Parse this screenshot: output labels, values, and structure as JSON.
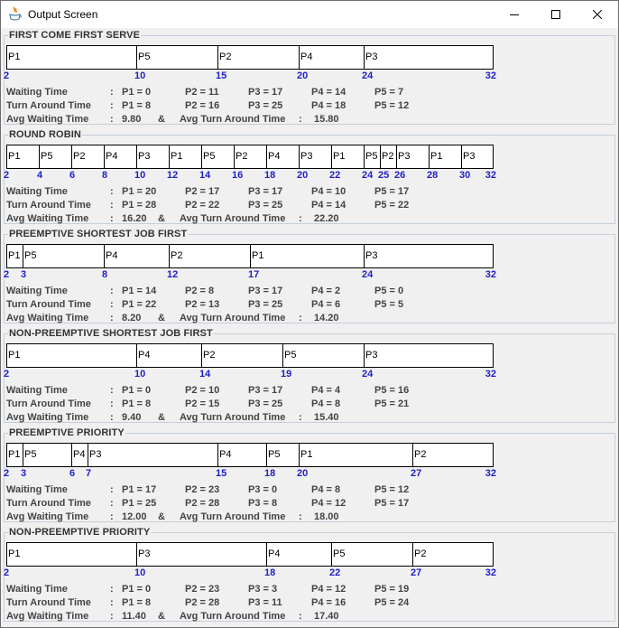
{
  "window": {
    "title": "Output Screen"
  },
  "labels": {
    "waiting": "Waiting Time",
    "turnaround": "Turn Around Time",
    "avg_waiting": "Avg Waiting Time",
    "avg_turnaround": "Avg Turn Around Time",
    "amp": "&"
  },
  "sections": [
    {
      "title": "FIRST COME FIRST SERVE",
      "segments": [
        "P1",
        "P5",
        "P2",
        "P4",
        "P3"
      ],
      "ticks": [
        "2",
        "10",
        "15",
        "20",
        "24",
        "32"
      ],
      "waiting": [
        "P1 = 0",
        "P2 = 11",
        "P3 = 17",
        "P4 = 14",
        "P5 = 7"
      ],
      "turnaround": [
        "P1 = 8",
        "P2 = 16",
        "P3 = 25",
        "P4 = 18",
        "P5 = 12"
      ],
      "avg_waiting": "9.80",
      "avg_turnaround": "15.80"
    },
    {
      "title": "ROUND ROBIN",
      "segments": [
        "P1",
        "P5",
        "P2",
        "P4",
        "P3",
        "P1",
        "P5",
        "P2",
        "P4",
        "P3",
        "P1",
        "P5",
        "P2",
        "P3",
        "P1",
        "P3"
      ],
      "ticks": [
        "2",
        "4",
        "6",
        "8",
        "10",
        "12",
        "14",
        "16",
        "18",
        "20",
        "22",
        "24",
        "25",
        "26",
        "28",
        "30",
        "32"
      ],
      "waiting": [
        "P1 = 20",
        "P2 = 17",
        "P3 = 17",
        "P4 = 10",
        "P5 = 17"
      ],
      "turnaround": [
        "P1 = 28",
        "P2 = 22",
        "P3 = 25",
        "P4 = 14",
        "P5 = 22"
      ],
      "avg_waiting": "16.20",
      "avg_turnaround": "22.20"
    },
    {
      "title": "PREEMPTIVE SHORTEST JOB FIRST",
      "segments": [
        "P1",
        "P5",
        "P4",
        "P2",
        "P1",
        "P3"
      ],
      "ticks": [
        "2",
        "3",
        "8",
        "12",
        "17",
        "24",
        "32"
      ],
      "waiting": [
        "P1 = 14",
        "P2 = 8",
        "P3 = 17",
        "P4 = 2",
        "P5 = 0"
      ],
      "turnaround": [
        "P1 = 22",
        "P2 = 13",
        "P3 = 25",
        "P4 = 6",
        "P5 = 5"
      ],
      "avg_waiting": "8.20",
      "avg_turnaround": "14.20"
    },
    {
      "title": "NON-PREEMPTIVE SHORTEST JOB FIRST",
      "segments": [
        "P1",
        "P4",
        "P2",
        "P5",
        "P3"
      ],
      "ticks": [
        "2",
        "10",
        "14",
        "19",
        "24",
        "32"
      ],
      "waiting": [
        "P1 = 0",
        "P2 = 10",
        "P3 = 17",
        "P4 = 4",
        "P5 = 16"
      ],
      "turnaround": [
        "P1 = 8",
        "P2 = 15",
        "P3 = 25",
        "P4 = 8",
        "P5 = 21"
      ],
      "avg_waiting": "9.40",
      "avg_turnaround": "15.40"
    },
    {
      "title": "PREEMPTIVE PRIORITY",
      "segments": [
        "P1",
        "P5",
        "P4",
        "P3",
        "P4",
        "P5",
        "P1",
        "P2"
      ],
      "ticks": [
        "2",
        "3",
        "6",
        "7",
        "15",
        "18",
        "20",
        "27",
        "32"
      ],
      "waiting": [
        "P1 = 17",
        "P2 = 23",
        "P3 = 0",
        "P4 = 8",
        "P5 = 12"
      ],
      "turnaround": [
        "P1 = 25",
        "P2 = 28",
        "P3 = 8",
        "P4 = 12",
        "P5 = 17"
      ],
      "avg_waiting": "12.00",
      "avg_turnaround": "18.00"
    },
    {
      "title": "NON-PREEMPTIVE PRIORITY",
      "segments": [
        "P1",
        "P3",
        "P4",
        "P5",
        "P2"
      ],
      "ticks": [
        "2",
        "10",
        "18",
        "22",
        "27",
        "32"
      ],
      "waiting": [
        "P1 = 0",
        "P2 = 23",
        "P3 = 3",
        "P4 = 12",
        "P5 = 19"
      ],
      "turnaround": [
        "P1 = 8",
        "P2 = 28",
        "P3 = 11",
        "P4 = 16",
        "P5 = 24"
      ],
      "avg_waiting": "11.40",
      "avg_turnaround": "17.40"
    }
  ]
}
